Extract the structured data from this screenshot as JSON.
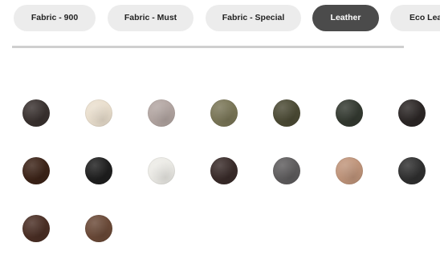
{
  "tabs": [
    {
      "label": "Fabric - 900",
      "active": false
    },
    {
      "label": "Fabric - Must",
      "active": false
    },
    {
      "label": "Fabric - Special",
      "active": false
    },
    {
      "label": "Leather",
      "active": true
    },
    {
      "label": "Eco Lea",
      "active": false
    }
  ],
  "swatches": [
    {
      "color": "#3a3230"
    },
    {
      "color": "#eadfce"
    },
    {
      "color": "#b3a6a2"
    },
    {
      "color": "#7a7657"
    },
    {
      "color": "#4c4b35"
    },
    {
      "color": "#343a31"
    },
    {
      "color": "#2c2726"
    },
    {
      "color": "#3d2418"
    },
    {
      "color": "#1f1f1f"
    },
    {
      "color": "#ecebe6"
    },
    {
      "color": "#3a2c2a"
    },
    {
      "color": "#5f5d5e"
    },
    {
      "color": "#c0957b"
    },
    {
      "color": "#303030"
    },
    {
      "color": "#4b2f25"
    },
    {
      "color": "#6b4a38"
    }
  ]
}
